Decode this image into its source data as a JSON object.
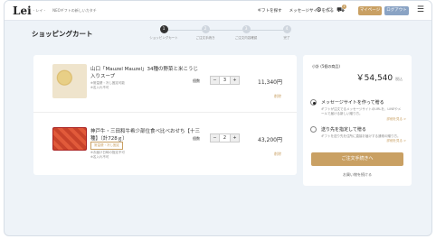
{
  "header": {
    "logo": "Lei",
    "logo_sub": "- レイ -",
    "tagline": "NEOギフトの新しいカタチ",
    "nav": [
      "ギフトを探す",
      "メッセージサイトを作る"
    ],
    "cart_badge": "1",
    "mypage_label": "マイページ",
    "logout_label": "ログアウト",
    "accent_color": "#c9a063",
    "logout_color": "#8aa3c4"
  },
  "page_title": "ショッピングカート",
  "steps": [
    {
      "num": "1",
      "label": "ショッピングカート",
      "active": true
    },
    {
      "num": "2",
      "label": "ご注文手続き",
      "active": false
    },
    {
      "num": "3",
      "label": "ご注文内容確認",
      "active": false
    },
    {
      "num": "4",
      "label": "完了",
      "active": false
    }
  ],
  "cart": {
    "qty_label": "個数",
    "delete_label": "削除",
    "items": [
      {
        "name": "山口「Mauzel Mauzel」34種の野菜と米こうじ入りスープ",
        "meta1": "※常温便・冷し固定可能",
        "meta2": "※名入れ不可",
        "qty": "3",
        "price": "11,340円"
      },
      {
        "name": "神戸牛・三田和牛希少部位食べ比べおせち【十三種】（計728ｇ）",
        "tag": "常温便・冷し固定",
        "meta1": "※お届け日時の指定不可",
        "meta2": "※名入れ不可",
        "qty": "2",
        "price": "43,200円"
      }
    ]
  },
  "summary": {
    "subtotal_label": "小計 (5個の商品)",
    "subtotal": "￥54,540",
    "subtotal_tax": "税込",
    "option1_title": "メッセージサイトを作って贈る",
    "option1_desc": "ギフトが注文でるメッセージサイトのURLを、LINEやメールで届ける新しい贈り方。",
    "option1_link": "詳細を見る >",
    "option2_title": "送り先を指定して贈る",
    "option2_desc": "ギフトを送り先を住所に直接お届けする通常の贈り方。",
    "option2_link": "詳細を見る >",
    "order_button": "ご注文手続きへ",
    "continue_link": "お買い物を続ける"
  }
}
